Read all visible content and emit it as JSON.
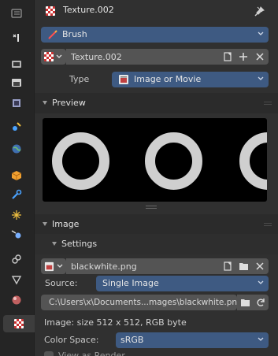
{
  "header": {
    "title": "Texture.002"
  },
  "brush": {
    "label": "Brush"
  },
  "texture": {
    "name": "Texture.002",
    "type_label": "Type",
    "type_value": "Image or Movie"
  },
  "preview": {
    "title": "Preview"
  },
  "image": {
    "title": "Image",
    "settings_title": "Settings",
    "file_name": "blackwhite.png",
    "source_label": "Source:",
    "source_value": "Single Image",
    "path": "C:\\Users\\x\\Documents...mages\\blackwhite.png",
    "info": "Image: size 512 x 512, RGB byte",
    "colorspace_label": "Color Space:",
    "colorspace_value": "sRGB",
    "view_as_render": "View as Render"
  },
  "tabs": [
    "tool-icon",
    "render-icon",
    "output-icon",
    "view-layer-icon",
    "scene-icon",
    "world-icon",
    "object-icon",
    "modifier-icon",
    "particles-icon",
    "physics-icon",
    "constraints-icon",
    "data-icon",
    "material-icon",
    "texture-icon"
  ],
  "colors": {
    "accent": "#3e5a82",
    "panel": "#303030",
    "tabbar": "#252525"
  }
}
